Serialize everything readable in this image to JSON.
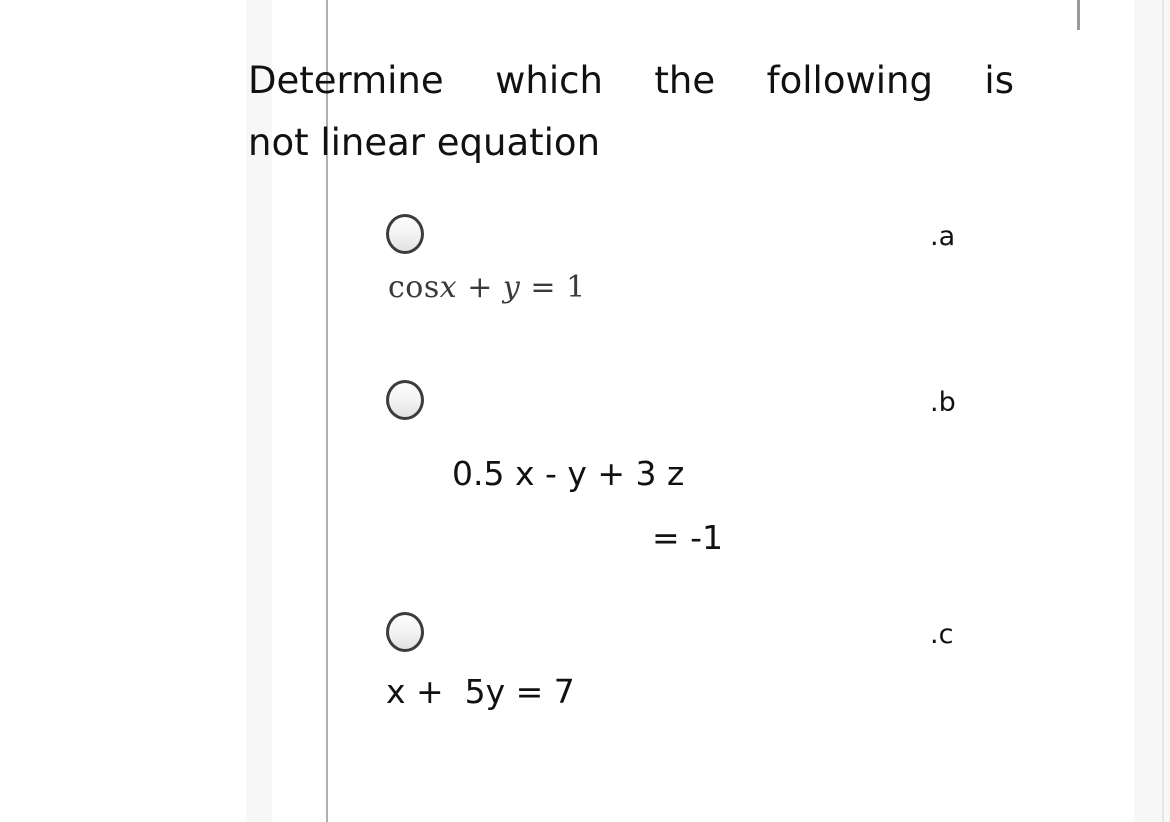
{
  "question": {
    "line1": "Determine which the following is",
    "line2": "not linear equation"
  },
  "options": [
    {
      "letter": ".a",
      "equation_prefix": "cos",
      "equation_var1": "x",
      "equation_op1": " + ",
      "equation_var2": "y",
      "equation_tail": " = 1",
      "equation_plain": "cos x + y = 1",
      "selected": false
    },
    {
      "letter": ".b",
      "equation_line1": "0.5 x - y + 3 z",
      "equation_line2": "= -1",
      "equation_plain": "0.5 x - y + 3 z = -1",
      "selected": false
    },
    {
      "letter": ".c",
      "equation_line1": "x +  5y = 7",
      "equation_plain": "x + 5y = 7",
      "selected": false
    }
  ],
  "colors": {
    "text": "#111111",
    "math_text": "#3a3a3a",
    "band": "#f7f7f7",
    "rule": "#b0b0b0",
    "radio_border": "#3c3c3c"
  }
}
